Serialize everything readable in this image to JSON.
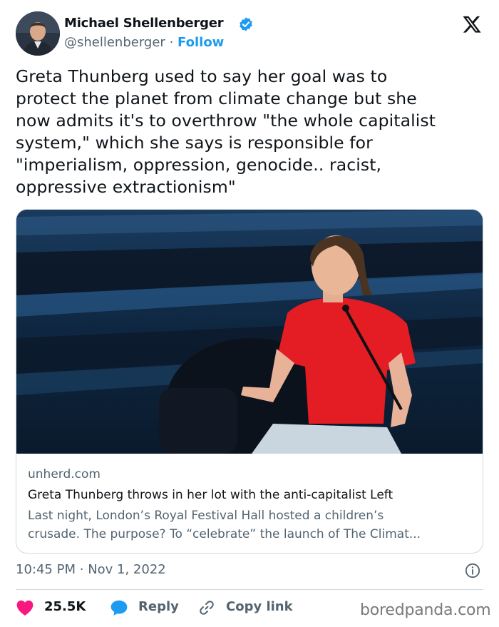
{
  "author": {
    "name": "Michael Shellenberger",
    "handle": "@shellenberger",
    "separator": "·",
    "follow_label": "Follow",
    "verified": true
  },
  "icons": {
    "platform": "x-logo-icon",
    "verified": "verified-badge-icon",
    "info": "info-icon",
    "like": "heart-icon",
    "reply": "reply-bubble-icon",
    "copy": "link-icon"
  },
  "tweet": {
    "lines": [
      "Greta Thunberg used to say her goal was to",
      "protect the planet from climate change but she",
      "now admits it's to overthrow \"the whole capitalist",
      "system,\" which she says is responsible for",
      "\"imperialism, oppression, genocide.. racist,",
      "oppressive extractionism\""
    ]
  },
  "card": {
    "domain": "unherd.com",
    "title": "Greta Thunberg throws in her lot with the anti-capitalist Left",
    "description_lines": [
      "Last night, London’s Royal Festival Hall hosted a children’s",
      "crusade. The purpose? To “celebrate” the launch of The Climat..."
    ]
  },
  "meta": {
    "time": "10:45 PM",
    "separator": "·",
    "date": "Nov 1, 2022"
  },
  "actions": {
    "like_count": "25.5K",
    "reply_label": "Reply",
    "copy_label": "Copy link"
  },
  "watermark": "boredpanda.com",
  "colors": {
    "accent": "#1d9bf0",
    "like": "#f91880",
    "text": "#0f1419",
    "secondary": "#536471",
    "border": "#cfd9de"
  }
}
